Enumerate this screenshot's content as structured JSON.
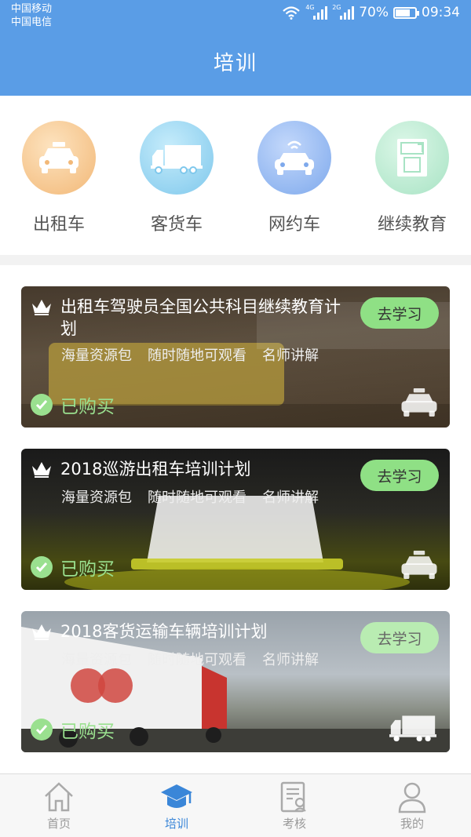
{
  "status_bar": {
    "carrier_1": "中国移动",
    "carrier_2": "中国电信",
    "net_1": "4G",
    "net_2": "2G",
    "battery": "70%",
    "time": "09:34"
  },
  "header": {
    "title": "培训"
  },
  "categories": [
    {
      "label": "出租车",
      "icon": "taxi-icon",
      "color": "#f4c58e"
    },
    {
      "label": "客货车",
      "icon": "truck-icon",
      "color": "#8fd0ef"
    },
    {
      "label": "网约车",
      "icon": "online-car-icon",
      "color": "#8fb6ef"
    },
    {
      "label": "继续教育",
      "icon": "education-book-icon",
      "color": "#b9ead0"
    }
  ],
  "courses": [
    {
      "title": "出租车驾驶员全国公共科目继续教育计划",
      "tags": [
        "海量资源包",
        "随时随地可观看",
        "名师讲解"
      ],
      "button": "去学习",
      "status": "已购买",
      "type_icon": "taxi-icon"
    },
    {
      "title": "2018巡游出租车培训计划",
      "tags": [
        "海量资源包",
        "随时随地可观看",
        "名师讲解"
      ],
      "button": "去学习",
      "status": "已购买",
      "type_icon": "taxi-icon"
    },
    {
      "title": "2018客货运输车辆培训计划",
      "tags": [
        "海量资源包",
        "随时随地可观看",
        "名师讲解"
      ],
      "button": "去学习",
      "status": "已购买",
      "type_icon": "truck-icon"
    }
  ],
  "tabbar": {
    "items": [
      {
        "label": "首页",
        "icon": "home-icon",
        "active": false
      },
      {
        "label": "培训",
        "icon": "graduation-cap-icon",
        "active": true
      },
      {
        "label": "考核",
        "icon": "exam-document-icon",
        "active": false
      },
      {
        "label": "我的",
        "icon": "user-icon",
        "active": false
      }
    ],
    "active_color": "#3a86d8"
  }
}
